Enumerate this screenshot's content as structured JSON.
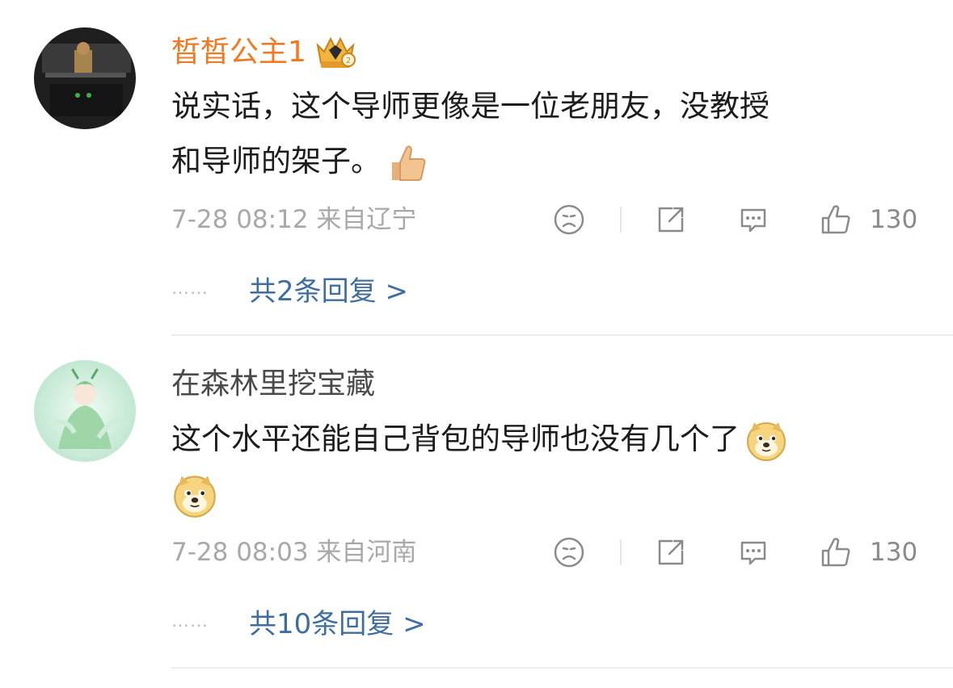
{
  "comments": [
    {
      "username": "晳晳公主1",
      "text_lines": [
        "说实话，这个导师更像是一位老朋友，没教授",
        "和导师的架子。"
      ],
      "time": "7-28 08:12",
      "location": "来自辽宁",
      "like_count": "130",
      "reply_link": "共2条回复 >",
      "badge": "vip-crown-icon"
    },
    {
      "username": "在森林里挖宝藏",
      "text_lines": [
        "这个水平还能自己背包的导师也没有几个了",
        ""
      ],
      "time": "7-28 08:03",
      "location": "来自河南",
      "like_count": "130",
      "reply_link": "共10条回复 >"
    }
  ],
  "icons": {
    "meta": [
      "sad-face-icon",
      "share-icon",
      "comment-icon",
      "thumbs-up-icon"
    ],
    "emoji_1": "thumbs-up-emoji",
    "emoji_2": "doge-emoji"
  },
  "colors": {
    "username_vip": "#f07a24",
    "username_normal": "#4a4a4a",
    "reply_link": "#3f6e9e",
    "meta": "#a8a8a8"
  },
  "more_dots": "……"
}
